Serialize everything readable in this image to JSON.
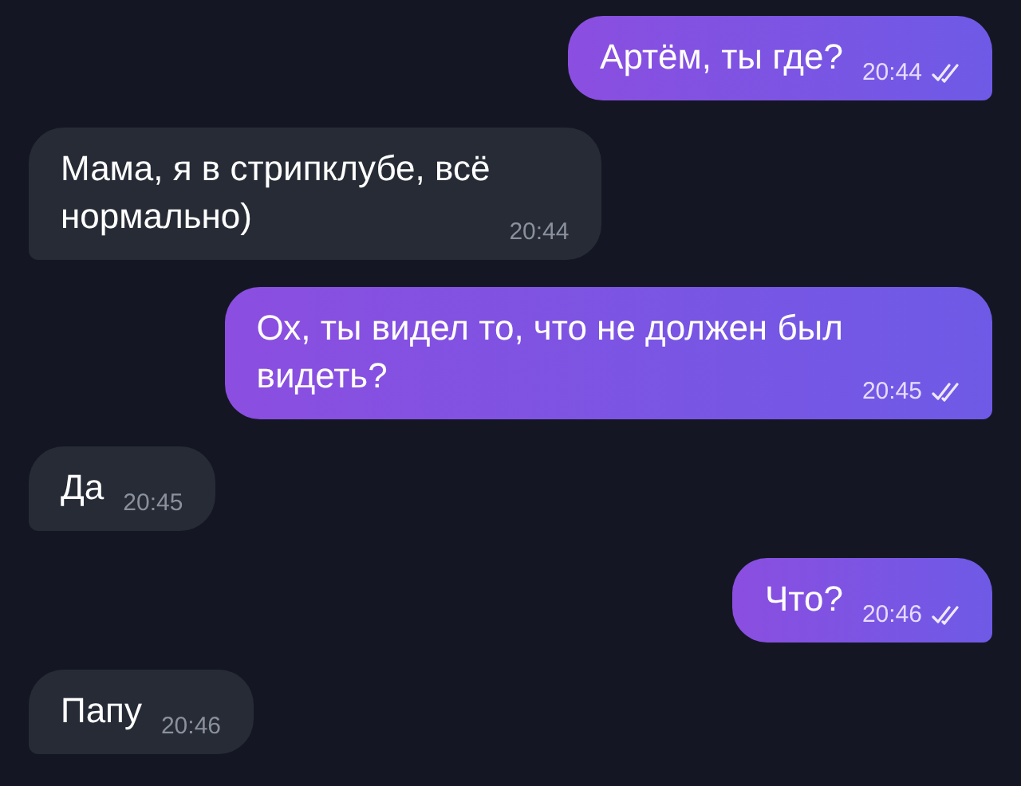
{
  "messages": [
    {
      "kind": "outgoing",
      "lines": [
        "Артём, ты где?"
      ],
      "time": "20:44",
      "read": true
    },
    {
      "kind": "incoming",
      "lines": [
        "Мама, я в стрипклубе, всё",
        "нормально)"
      ],
      "time": "20:44"
    },
    {
      "kind": "outgoing",
      "lines": [
        "Ох, ты видел то, что не должен был",
        "видеть?"
      ],
      "time": "20:45",
      "read": true
    },
    {
      "kind": "incoming",
      "lines": [
        "Да"
      ],
      "time": "20:45"
    },
    {
      "kind": "outgoing",
      "lines": [
        "Что?"
      ],
      "time": "20:46",
      "read": true
    },
    {
      "kind": "incoming",
      "lines": [
        "Папу"
      ],
      "time": "20:46"
    }
  ]
}
